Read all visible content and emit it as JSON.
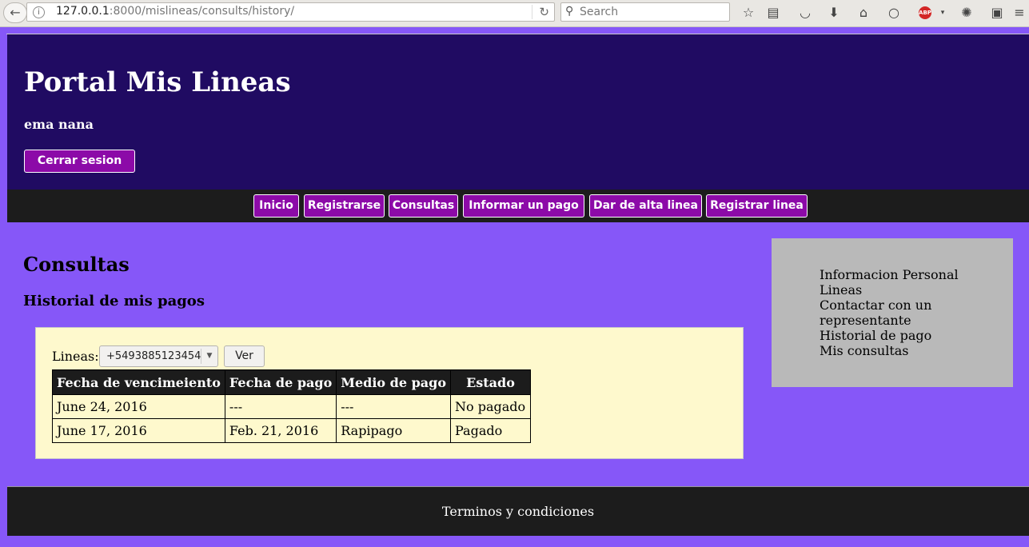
{
  "browser": {
    "url_host": "127.0.0.1",
    "url_port_path": ":8000/mislineas/consults/history/",
    "search_placeholder": "Search",
    "back_symbol": "←",
    "reload_symbol": "↻",
    "abp_label": "ABP"
  },
  "header": {
    "site_title": "Portal Mis Lineas",
    "user_name": "ema nana",
    "logout_label": "Cerrar sesion"
  },
  "nav": {
    "items": [
      {
        "label": "Inicio"
      },
      {
        "label": "Registrarse"
      },
      {
        "label": "Consultas"
      },
      {
        "label": "Informar un pago"
      },
      {
        "label": "Dar de alta linea"
      },
      {
        "label": "Registrar linea"
      }
    ]
  },
  "main": {
    "title": "Consultas",
    "subtitle": "Historial de mis pagos",
    "lineas_label": "Lineas:",
    "selected_line": "+5493885123454",
    "ver_label": "Ver",
    "table": {
      "headers": [
        "Fecha de vencimeiento",
        "Fecha de pago",
        "Medio de pago",
        "Estado"
      ],
      "rows": [
        [
          "June 24, 2016",
          "---",
          "---",
          "No pagado"
        ],
        [
          "June 17, 2016",
          "Feb. 21, 2016",
          "Rapipago",
          "Pagado"
        ]
      ]
    }
  },
  "sidebar": {
    "items": [
      {
        "label": "Informacion Personal"
      },
      {
        "label": "Lineas"
      },
      {
        "label": "Contactar con un representante"
      },
      {
        "label": "Historial de pago"
      },
      {
        "label": "Mis consultas"
      }
    ]
  },
  "footer": {
    "link": "Terminos y condiciones"
  },
  "colors": {
    "page_bg": "#8657f8",
    "header_bg": "#200b62",
    "nav_bg": "#1c1c1c",
    "button_bg": "#8c0aa8",
    "content_bg": "#fef9cd",
    "sidebar_bg": "#b9b9b9"
  }
}
